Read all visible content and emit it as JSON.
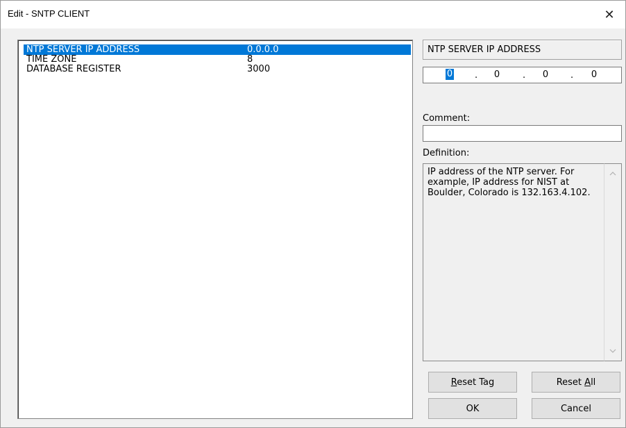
{
  "window": {
    "title": "Edit - SNTP CLIENT",
    "close_glyph": "✕"
  },
  "params": [
    {
      "name": "NTP SERVER IP ADDRESS",
      "value": "0.0.0.0",
      "selected": true
    },
    {
      "name": "TIME ZONE",
      "value": "8",
      "selected": false
    },
    {
      "name": "DATABASE REGISTER",
      "value": "3000",
      "selected": false
    }
  ],
  "editor": {
    "param_name": "NTP SERVER IP ADDRESS",
    "ip_octets": [
      "0",
      "0",
      "0",
      "0"
    ],
    "ip_separator": ".",
    "comment_label": "Comment:",
    "comment_value": "",
    "definition_label": "Definition:",
    "definition_text": "IP address of the NTP server. For example, IP address for NIST at Boulder, Colorado is 132.163.4.102."
  },
  "buttons": {
    "reset_tag": {
      "pre": "",
      "key": "R",
      "post": "eset Tag"
    },
    "reset_all": {
      "pre": "Reset ",
      "key": "A",
      "post": "ll"
    },
    "ok": "OK",
    "cancel": "Cancel"
  },
  "icons": {
    "close": "close-icon",
    "scroll_up": "chevron-up-icon",
    "scroll_down": "chevron-down-icon"
  },
  "colors": {
    "selection": "#0078d7",
    "dialog_bg": "#f0f0f0"
  }
}
